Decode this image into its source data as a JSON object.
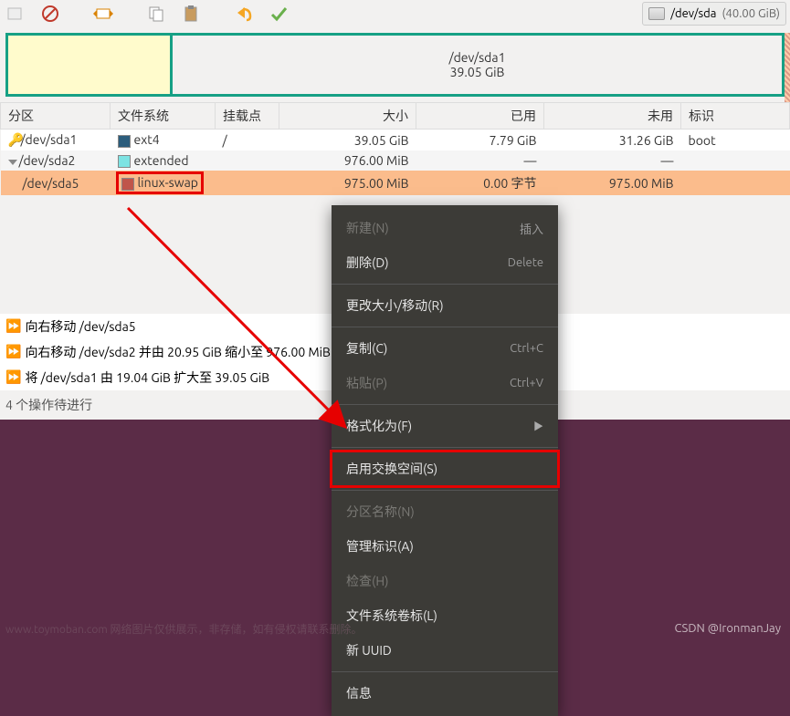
{
  "toolbar": {
    "device_label": "/dev/sda",
    "device_size": "(40.00 GiB)"
  },
  "partbar": {
    "main_name": "/dev/sda1",
    "main_size": "39.05 GiB"
  },
  "headers": {
    "partition": "分区",
    "fs": "文件系统",
    "mount": "挂载点",
    "size": "大小",
    "used": "已用",
    "unused": "未用",
    "flags": "标识"
  },
  "rows": [
    {
      "name": "/dev/sda1",
      "fs": "ext4",
      "mount": "/",
      "size": "39.05 GiB",
      "used": "7.79 GiB",
      "unused": "31.26 GiB",
      "flags": "boot",
      "key": true
    },
    {
      "name": "/dev/sda2",
      "fs": "extended",
      "mount": "",
      "size": "976.00 MiB",
      "used": "—",
      "unused": "—",
      "flags": ""
    },
    {
      "name": "/dev/sda5",
      "fs": "linux-swap",
      "mount": "",
      "size": "975.00 MiB",
      "used": "0.00 字节",
      "unused": "975.00 MiB",
      "flags": ""
    }
  ],
  "ops": {
    "items": [
      "向右移动 /dev/sda5",
      "向右移动 /dev/sda2 并由 20.95 GiB 缩小至 976.00 MiB",
      "将 /dev/sda1 由 19.04 GiB 扩大至 39.05 GiB"
    ],
    "summary": "4 个操作待进行"
  },
  "menu": {
    "new": "新建(N)",
    "new_sc": "插入",
    "delete": "删除(D)",
    "delete_sc": "Delete",
    "resize": "更改大小/移动(R)",
    "copy": "复制(C)",
    "copy_sc": "Ctrl+C",
    "paste": "粘贴(P)",
    "paste_sc": "Ctrl+V",
    "format": "格式化为(F)",
    "swapon": "启用交换空间(S)",
    "name": "分区名称(N)",
    "flags": "管理标识(A)",
    "check": "检查(H)",
    "label": "文件系统卷标(L)",
    "uuid": "新 UUID",
    "info": "信息"
  },
  "watermark": {
    "left": "www.toymoban.com 网络图片仅供展示，非存储，如有侵权请联系删除。",
    "right": "CSDN @IronmanJay"
  }
}
